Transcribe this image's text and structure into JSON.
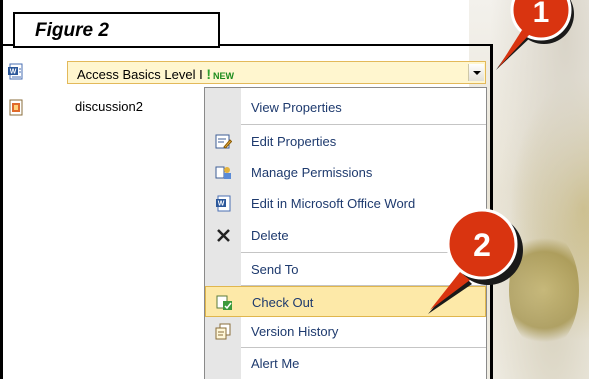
{
  "caption": "Figure 2",
  "list": {
    "row1": {
      "title": "Access Basics Level I",
      "new_mark": "!",
      "new_badge": "NEW",
      "icon": "word-document-icon"
    },
    "row2": {
      "title": "discussion2",
      "icon": "discussion-icon"
    }
  },
  "menu": {
    "items": [
      {
        "label": "View Properties",
        "icon": ""
      },
      {
        "label": "Edit Properties",
        "icon": "edit-properties-icon"
      },
      {
        "label": "Manage Permissions",
        "icon": "permissions-icon"
      },
      {
        "label": "Edit in Microsoft Office Word",
        "icon": "word-icon"
      },
      {
        "label": "Delete",
        "icon": "delete-x-icon"
      },
      {
        "label": "Send To",
        "icon": ""
      },
      {
        "label": "Check Out",
        "icon": "check-out-icon",
        "highlighted": true
      },
      {
        "label": "Version History",
        "icon": "version-history-icon"
      },
      {
        "label": "Alert Me",
        "icon": ""
      }
    ]
  },
  "callouts": {
    "one": "1",
    "two": "2"
  },
  "colors": {
    "callout_red": "#d93410",
    "menu_highlight": "#fde9a8",
    "field_bg": "#fff6cf"
  }
}
